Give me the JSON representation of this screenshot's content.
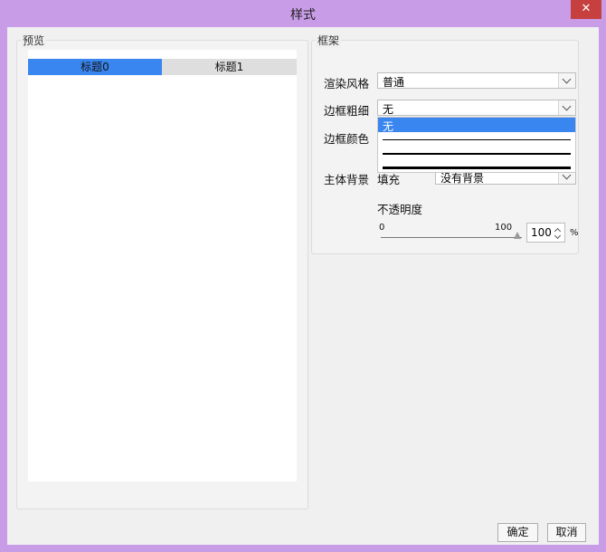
{
  "window": {
    "title": "样式",
    "close_glyph": "✕"
  },
  "preview": {
    "group_label": "预览",
    "tabs": [
      "标题0",
      "标题1"
    ]
  },
  "frame": {
    "group_label": "框架",
    "render_style_label": "渲染风格",
    "render_style_value": "普通",
    "border_width_label": "边框粗细",
    "border_width_value": "无",
    "border_width_options": [
      "无",
      "thin-line",
      "medium-line",
      "thick-line"
    ],
    "border_color_label": "边框颜色",
    "body_bg_label": "主体背景",
    "fill_label": "填充",
    "fill_value": "没有背景",
    "opacity_label": "不透明度",
    "slider_min": "0",
    "slider_max": "100",
    "opacity_value": "100",
    "opacity_unit": "%"
  },
  "footer": {
    "ok": "确定",
    "cancel": "取消"
  },
  "colors": {
    "selection": "#3a86f0",
    "titlebar": "#c99ce8",
    "close": "#c74040"
  }
}
